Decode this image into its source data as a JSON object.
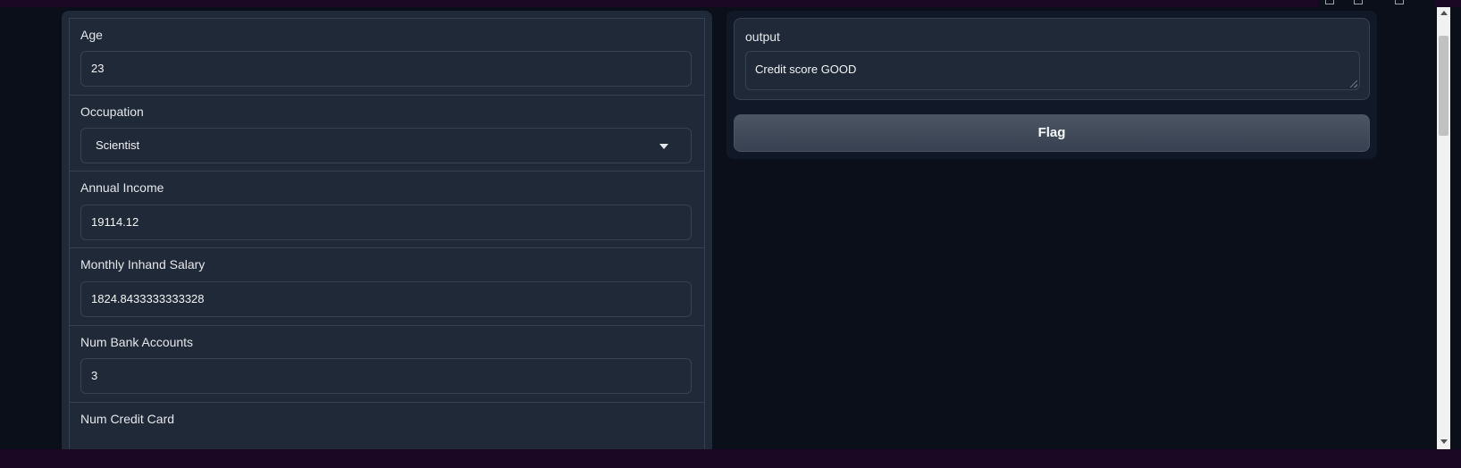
{
  "inputs": {
    "age": {
      "label": "Age",
      "value": "23"
    },
    "occupation": {
      "label": "Occupation",
      "value": "Scientist"
    },
    "annual_income": {
      "label": "Annual Income",
      "value": "19114.12"
    },
    "monthly_inhand_salary": {
      "label": "Monthly Inhand Salary",
      "value": "1824.8433333333328"
    },
    "num_bank_accounts": {
      "label": "Num Bank Accounts",
      "value": "3"
    },
    "num_credit_card": {
      "label": "Num Credit Card"
    }
  },
  "output": {
    "label": "output",
    "value": "Credit score GOOD"
  },
  "actions": {
    "flag_label": "Flag"
  },
  "icons": [
    "edit-icon",
    "image-icon",
    "trash-icon",
    "dropdown-caret-icon",
    "scroll-up-icon",
    "scroll-down-icon"
  ],
  "colors": {
    "background": "#0b0f19",
    "panel": "#1f2937",
    "border": "#374151",
    "button": "#4b5563",
    "frame": "#1a0825"
  }
}
